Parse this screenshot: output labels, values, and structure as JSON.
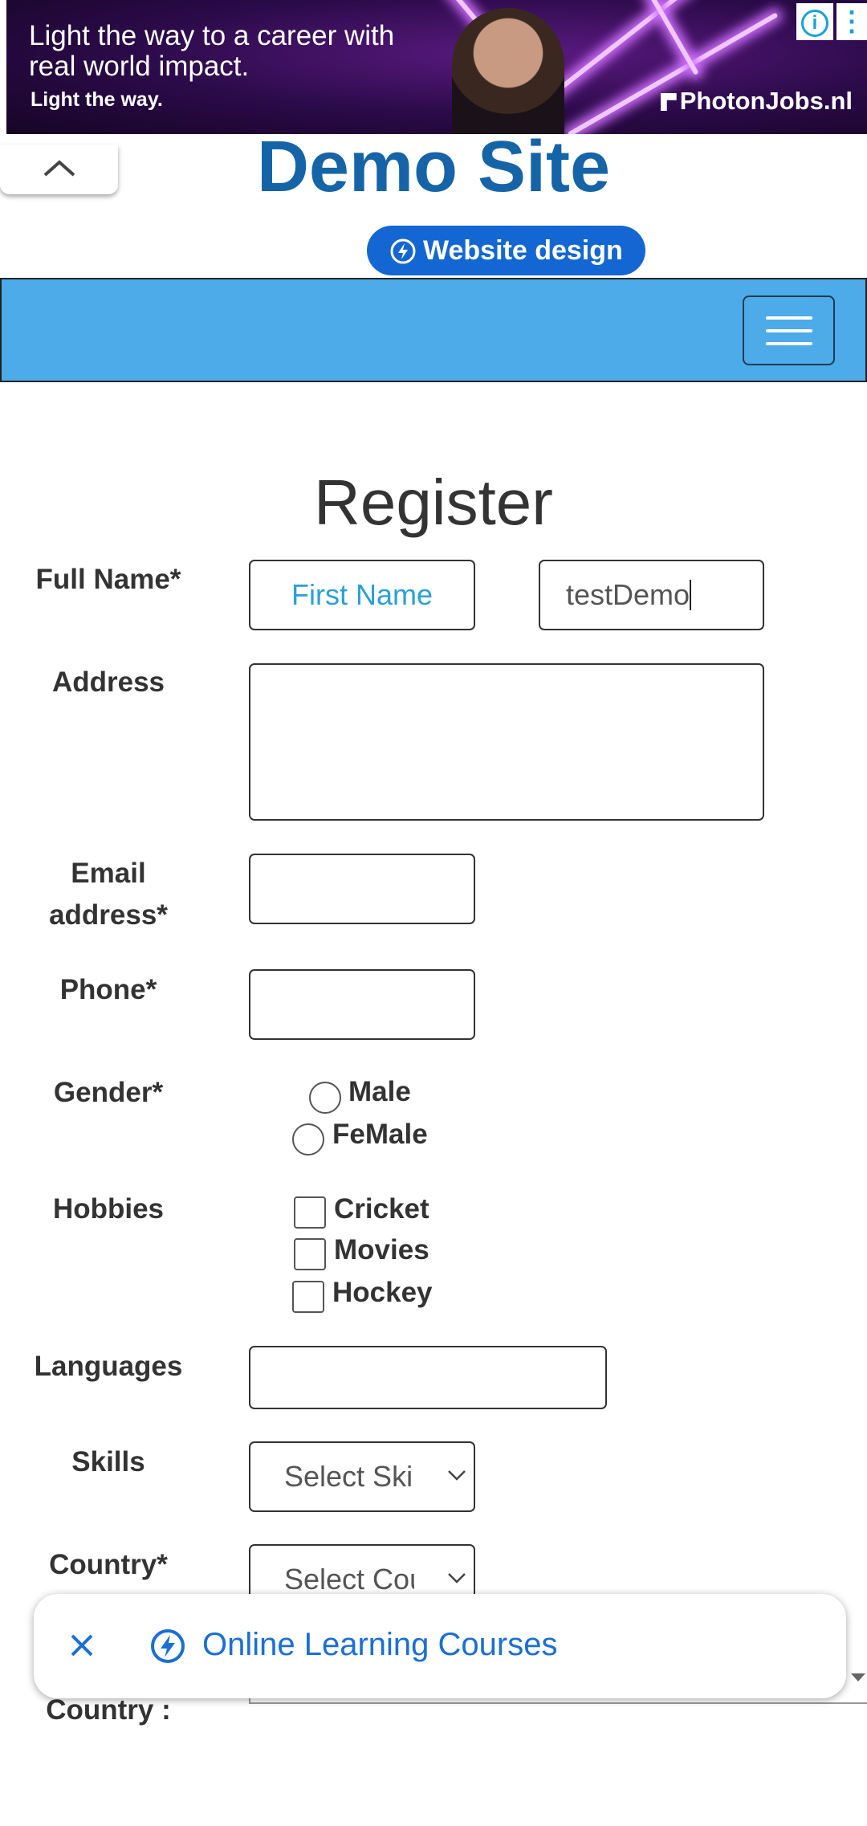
{
  "ad": {
    "headline": "Light the way to a career with real world impact.",
    "tagline": "Light the way.",
    "brand": "PhotonJobs.nl",
    "info_icon": "info-icon",
    "more_icon": "more-vertical-icon"
  },
  "header": {
    "collapse_icon": "chevron-up-icon",
    "site_title": "Demo Site",
    "design_link": "Website design"
  },
  "navbar": {
    "menu_icon": "hamburger-menu-icon",
    "color": "#4cabe8"
  },
  "form": {
    "heading": "Register",
    "full_name_label": "Full Name*",
    "first_name_placeholder": "First Name",
    "last_name_value": "testDemo",
    "address_label": "Address",
    "email_label_line1": "Email",
    "email_label_line2": "address*",
    "phone_label": "Phone*",
    "gender_label": "Gender*",
    "gender_options": [
      "Male",
      "FeMale"
    ],
    "hobbies_label": "Hobbies",
    "hobby_options": [
      "Cricket",
      "Movies",
      "Hockey"
    ],
    "languages_label": "Languages",
    "skills_label": "Skills",
    "skills_selected": "Select Skills",
    "country_label": "Country*",
    "country_selected": "Select Country",
    "select_country_label": "Country :"
  },
  "floating_bar": {
    "text": "Online Learning Courses",
    "close_icon": "close-icon",
    "bolt_icon": "bolt-icon"
  },
  "colors": {
    "title_blue": "#1664a8",
    "pill_blue": "#1467d2",
    "link_blue": "#1a6ed6",
    "placeholder_blue": "#2aa0d8"
  }
}
